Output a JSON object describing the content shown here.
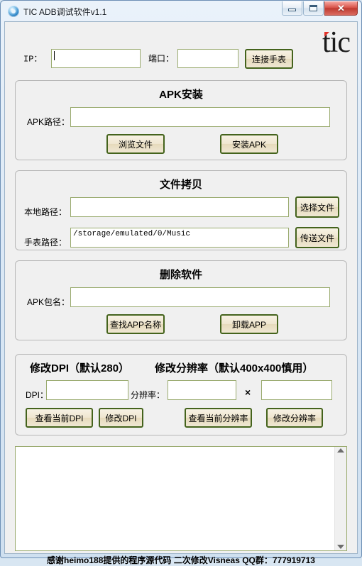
{
  "window": {
    "title": "TIC ADB调试软件v1.1",
    "icon": "app-disc-icon",
    "controls": {
      "minimize": "minimize-icon",
      "maximize": "maximize-icon",
      "close": "✕"
    },
    "accent_border": "#6d8fb5",
    "client_bg": "#f0f0f0"
  },
  "brand": {
    "logo_text": "tic",
    "tick_color": "#e2332a"
  },
  "connect": {
    "ip_label": "IP：",
    "ip_value": "",
    "port_label": "端口：",
    "port_value": "",
    "connect_button": "连接手表"
  },
  "apk_install": {
    "title": "APK安装",
    "path_label": "APK路径：",
    "path_value": "",
    "browse_button": "浏览文件",
    "install_button": "安装APK"
  },
  "file_copy": {
    "title": "文件拷贝",
    "local_label": "本地路径：",
    "local_value": "",
    "watch_label": "手表路径：",
    "watch_value": "/storage/emulated/0/Music",
    "choose_button": "选择文件",
    "send_button": "传送文件"
  },
  "uninstall": {
    "title": "删除软件",
    "package_label": "APK包名：",
    "package_value": "",
    "find_button": "查找APP名称",
    "uninstall_button": "卸载APP"
  },
  "display": {
    "dpi_title": "修改DPI（默认280）",
    "res_title": "修改分辨率（默认400x400慎用）",
    "dpi_label": "DPI：",
    "dpi_value": "",
    "res_label": "分辨率：",
    "res_width_value": "",
    "res_height_value": "",
    "multiply_symbol": "×",
    "view_dpi_button": "查看当前DPI",
    "set_dpi_button": "修改DPI",
    "view_res_button": "查看当前分辨率",
    "set_res_button": "修改分辨率"
  },
  "log": {
    "content": "",
    "scroll_up": "scroll-up-arrow",
    "scroll_down": "scroll-down-arrow"
  },
  "footer": {
    "text": "感谢heimo188提供的程序源代码 二次修改Visneas QQ群：777919713"
  }
}
